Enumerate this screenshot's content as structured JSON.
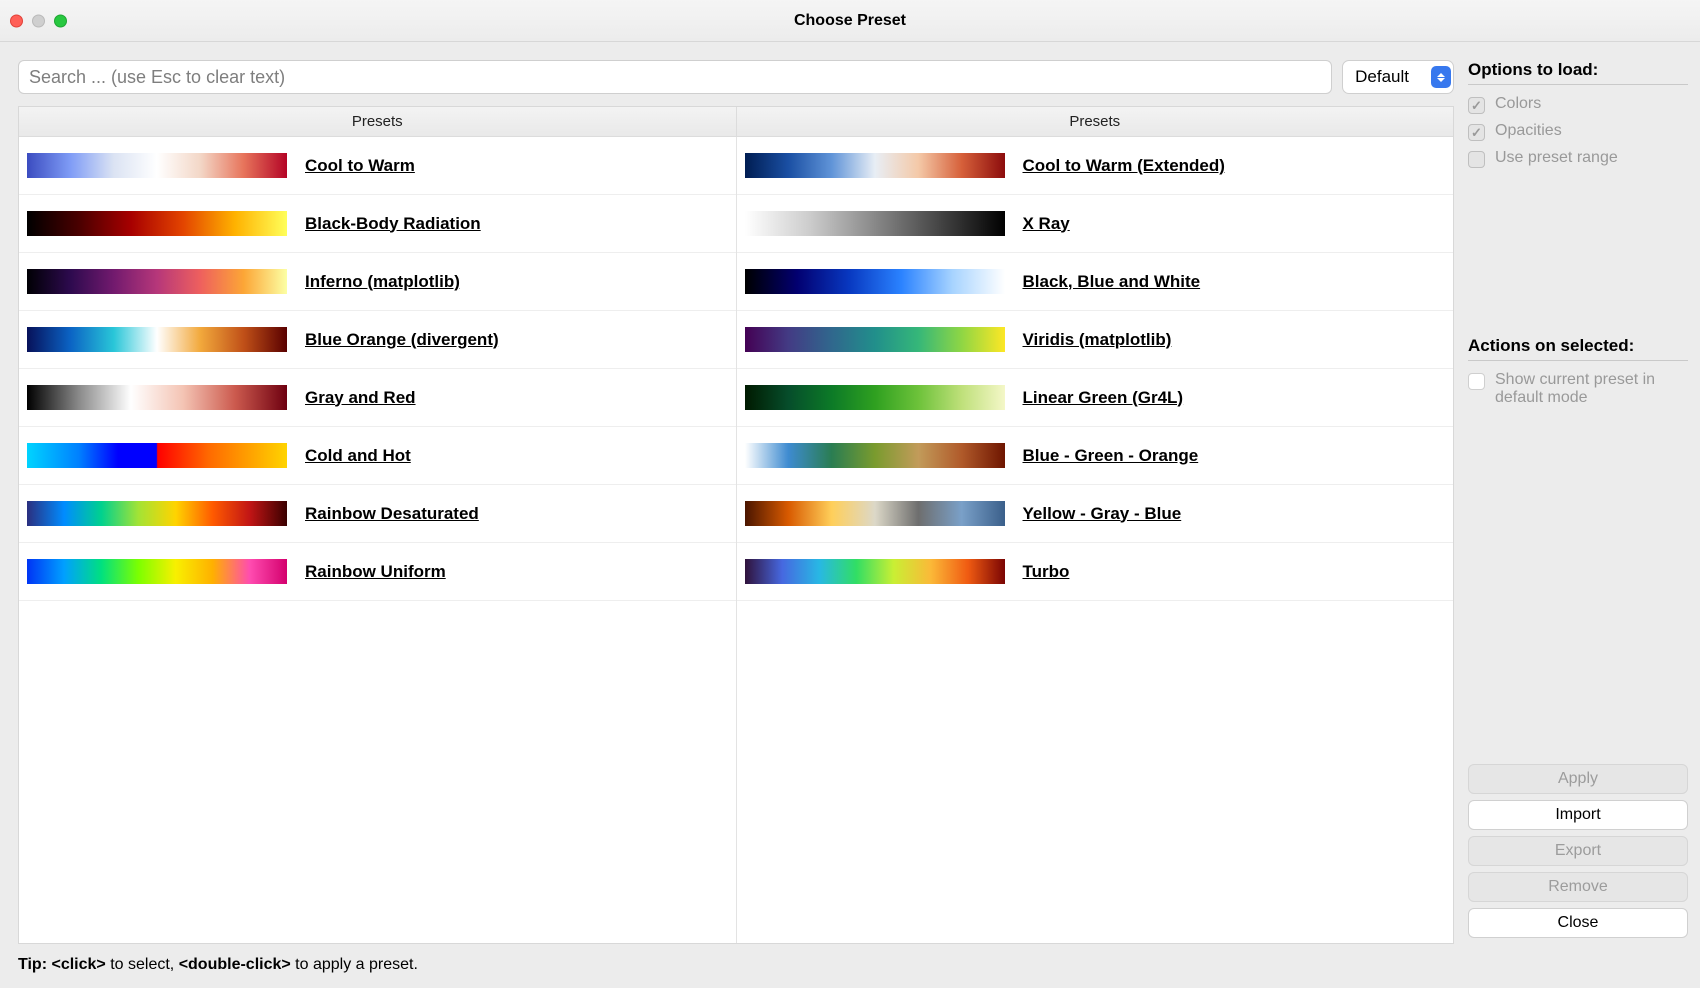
{
  "window": {
    "title": "Choose Preset"
  },
  "search": {
    "placeholder": "Search ... (use Esc to clear text)",
    "value": ""
  },
  "category": {
    "selected": "Default"
  },
  "columns": {
    "header": "Presets"
  },
  "presets_left": [
    {
      "name": "Cool to Warm",
      "gradient": "linear-gradient(to right,#3b4cc0,#7f9cf6,#dbe3f3,#ffffff,#f3d7c7,#e7745b,#b40426)"
    },
    {
      "name": "Black-Body Radiation",
      "gradient": "linear-gradient(to right,#000000,#4a0000,#a70000,#e34400,#ffb200,#ffff5a)"
    },
    {
      "name": "Inferno (matplotlib)",
      "gradient": "linear-gradient(to right,#000004,#2d0a4e,#721a6e,#b6377a,#ee605e,#fca636,#fcffa4)"
    },
    {
      "name": "Blue Orange (divergent)",
      "gradient": "linear-gradient(to right,#07115a,#0b63c4,#29c6d8,#ffffff,#f2a93c,#c05018,#5a0000)"
    },
    {
      "name": "Gray and Red",
      "gradient": "linear-gradient(to right,#000000,#8a8a8a,#ffffff,#f4c4b4,#cc5a4e,#6e0010)"
    },
    {
      "name": "Cold and Hot",
      "gradient": "linear-gradient(to right,#00d4ff 0%,#0080ff 20%,#0000ff 35%,#0000ff 49.8%,#ff0000 50.2%,#ff6a00 70%,#ffd400 100%)"
    },
    {
      "name": "Rainbow Desaturated",
      "gradient": "linear-gradient(to right,#2b2f7f,#008cff,#00d18e,#a3e335,#ffd400,#ff5a00,#c11515,#3a0000)"
    },
    {
      "name": "Rainbow Uniform",
      "gradient": "linear-gradient(to right,#0034f5,#00a0ff,#00e080,#7cff00,#f8f000,#ffb000,#ff4cb0,#d4006e)"
    }
  ],
  "presets_right": [
    {
      "name": "Cool to Warm (Extended)",
      "gradient": "linear-gradient(to right,#001d52,#1a4fa3,#6094d8,#e8eef5,#f4c9a8,#d6603a,#8c0c0c)"
    },
    {
      "name": "X Ray",
      "gradient": "linear-gradient(to right,#ffffff,#cccccc,#888888,#444444,#000000)"
    },
    {
      "name": "Black, Blue and White",
      "gradient": "linear-gradient(to right,#000000,#020070,#0838c0,#2a82ff,#a8d4ff,#ffffff)"
    },
    {
      "name": "Viridis (matplotlib)",
      "gradient": "linear-gradient(to right,#440154,#433b84,#30678d,#218f8b,#35b779,#8fd644,#fde725)"
    },
    {
      "name": "Linear Green (Gr4L)",
      "gradient": "linear-gradient(to right,#001a00,#064d2b,#0c7a27,#2fa020,#6dc23a,#bfe07a,#f4f7c8)"
    },
    {
      "name": "Blue - Green - Orange",
      "gradient": "linear-gradient(to right,#ffffff,#3e8bd0,#2a7d52,#7a9b2e,#c29b5a,#b05a2a,#6e1500)"
    },
    {
      "name": "Yellow - Gray - Blue",
      "gradient": "linear-gradient(to right,#4a1500,#d85a00,#ffcf5a,#dcd8c8,#6e6e6e,#7aa0c8,#3a5f8a)"
    },
    {
      "name": "Turbo",
      "gradient": "linear-gradient(to right,#30123b,#4668e0,#28b8e4,#31de64,#c9ef34,#fbb938,#f05b12,#7a0403)"
    }
  ],
  "options": {
    "title": "Options to load:",
    "colors": {
      "label": "Colors",
      "checked": true
    },
    "opacities": {
      "label": "Opacities",
      "checked": true
    },
    "use_preset_range": {
      "label": "Use preset range",
      "checked": false
    }
  },
  "actions": {
    "title": "Actions on selected:",
    "show_default": {
      "label": "Show current preset in default mode",
      "checked": false
    }
  },
  "buttons": {
    "apply": "Apply",
    "import": "Import",
    "export": "Export",
    "remove": "Remove",
    "close": "Close"
  },
  "tip": "Tip: <click> to select, <double-click> to apply a preset."
}
